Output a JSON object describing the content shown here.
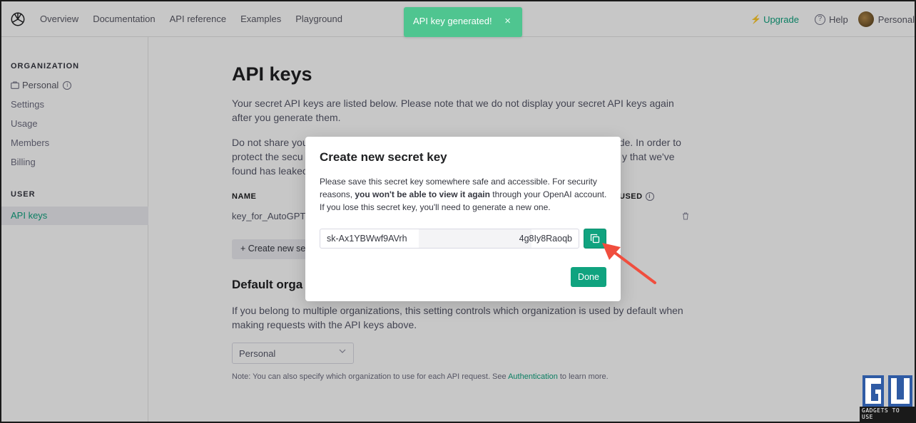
{
  "nav": {
    "links": [
      "Overview",
      "Documentation",
      "API reference",
      "Examples",
      "Playground"
    ],
    "upgrade": "Upgrade",
    "help": "Help",
    "account": "Personal"
  },
  "sidebar": {
    "org_heading": "ORGANIZATION",
    "org_name": "Personal",
    "items": [
      "Settings",
      "Usage",
      "Members",
      "Billing"
    ],
    "user_heading": "USER",
    "active_item": "API keys"
  },
  "main": {
    "title": "API keys",
    "intro": "Your secret API keys are listed below. Please note that we do not display your secret API keys again after you generate them.",
    "warning_line1": "Do not share you",
    "warning_line1_end": "ode. In order to",
    "warning_line2": "protect the secu",
    "warning_line2_end": "y that we've",
    "warning_line3": "found has leakec",
    "col_name": "NAME",
    "col_used": "USED",
    "key_name": "key_for_AutoGPT",
    "create_button": "+  Create new se",
    "default_org_heading": "Default orga",
    "default_org_text": "If you belong to multiple organizations, this setting controls which organization is used by default when making requests with the API keys above.",
    "select_value": "Personal",
    "note_prefix": "Note: You can also specify which organization to use for each API request. See ",
    "note_link": "Authentication",
    "note_suffix": " to learn more."
  },
  "toast": {
    "message": "API key generated!",
    "close": "×"
  },
  "modal": {
    "title": "Create new secret key",
    "text_a": "Please save this secret key somewhere safe and accessible. For security reasons, ",
    "text_bold": "you won't be able to view it again",
    "text_b": " through your OpenAI account. If you lose this secret key, you'll need to generate a new one.",
    "key_start": "sk-Ax1YBWwf9AVrh",
    "key_end": "4g8Iy8Raoqb",
    "done_button": "Done"
  },
  "watermark": {
    "text": "GADGETS TO USE"
  },
  "colors": {
    "accent": "#10a37f",
    "toast": "#4fc590",
    "arrow": "#f04e3e"
  }
}
